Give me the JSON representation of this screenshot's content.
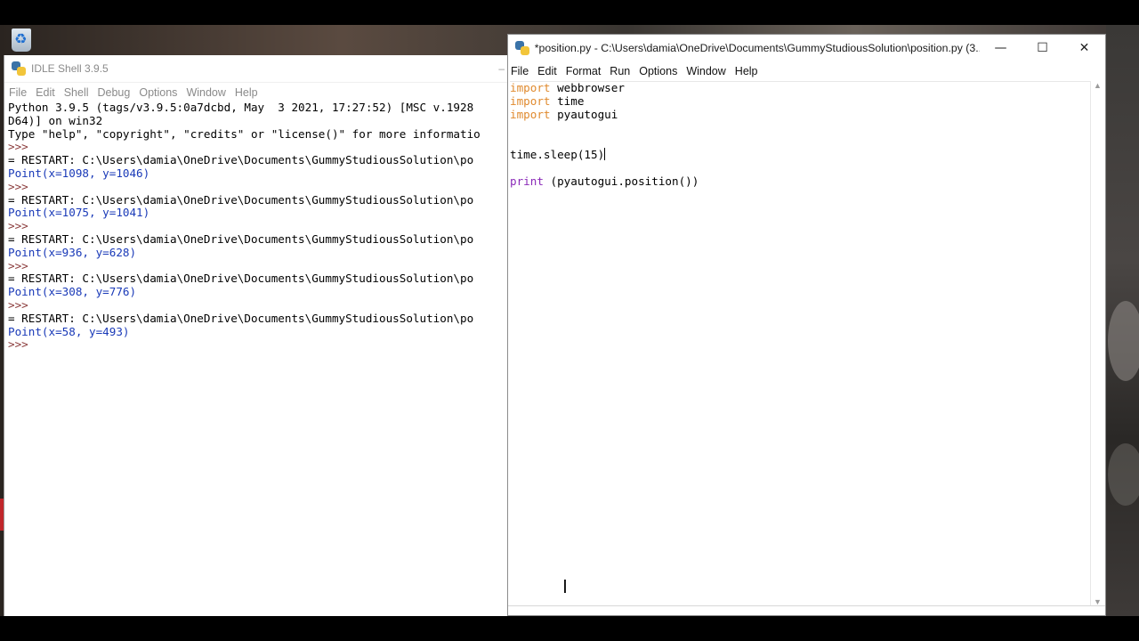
{
  "shell": {
    "title": "IDLE Shell 3.9.5",
    "minimize_glyph": "–",
    "menu": [
      "File",
      "Edit",
      "Shell",
      "Debug",
      "Options",
      "Window",
      "Help"
    ],
    "lines": [
      {
        "kind": "text",
        "text": "Python 3.9.5 (tags/v3.9.5:0a7dcbd, May  3 2021, 17:27:52) [MSC v.1928"
      },
      {
        "kind": "text",
        "text": "D64)] on win32"
      },
      {
        "kind": "text",
        "text": "Type \"help\", \"copyright\", \"credits\" or \"license()\" for more informatio"
      },
      {
        "kind": "prompt",
        "text": ">>>"
      },
      {
        "kind": "text",
        "text": "= RESTART: C:\\Users\\damia\\OneDrive\\Documents\\GummyStudiousSolution\\po"
      },
      {
        "kind": "out",
        "text": "Point(x=1098, y=1046)"
      },
      {
        "kind": "prompt",
        "text": ">>>"
      },
      {
        "kind": "text",
        "text": "= RESTART: C:\\Users\\damia\\OneDrive\\Documents\\GummyStudiousSolution\\po"
      },
      {
        "kind": "out",
        "text": "Point(x=1075, y=1041)"
      },
      {
        "kind": "prompt",
        "text": ">>>"
      },
      {
        "kind": "text",
        "text": "= RESTART: C:\\Users\\damia\\OneDrive\\Documents\\GummyStudiousSolution\\po"
      },
      {
        "kind": "out",
        "text": "Point(x=936, y=628)"
      },
      {
        "kind": "prompt",
        "text": ">>>"
      },
      {
        "kind": "text",
        "text": "= RESTART: C:\\Users\\damia\\OneDrive\\Documents\\GummyStudiousSolution\\po"
      },
      {
        "kind": "out",
        "text": "Point(x=308, y=776)"
      },
      {
        "kind": "prompt",
        "text": ">>>"
      },
      {
        "kind": "text",
        "text": "= RESTART: C:\\Users\\damia\\OneDrive\\Documents\\GummyStudiousSolution\\po"
      },
      {
        "kind": "out",
        "text": "Point(x=58, y=493)"
      },
      {
        "kind": "prompt",
        "text": ">>>"
      }
    ]
  },
  "editor": {
    "title": "*position.py - C:\\Users\\damia\\OneDrive\\Documents\\GummyStudiousSolution\\position.py (3...",
    "menu": [
      "File",
      "Edit",
      "Format",
      "Run",
      "Options",
      "Window",
      "Help"
    ],
    "controls": {
      "minimize": "—",
      "maximize": "☐",
      "close": "✕"
    },
    "code": {
      "import_keyword": "import",
      "imports": [
        " webbrowser",
        " time",
        " pyautogui"
      ],
      "sleep_line": "time.sleep(15)",
      "print_keyword": "print",
      "print_rest": " (pyautogui.position())"
    },
    "scroll": {
      "up": "▲",
      "down": "▼"
    }
  },
  "colors": {
    "keyword": "#e08a2e",
    "builtin": "#8a2ab8",
    "output": "#1a3ab8",
    "prompt": "#8a3a3a"
  },
  "icons": [
    "recycle-bin-icon",
    "python-icon",
    "ibeam-cursor-icon"
  ]
}
